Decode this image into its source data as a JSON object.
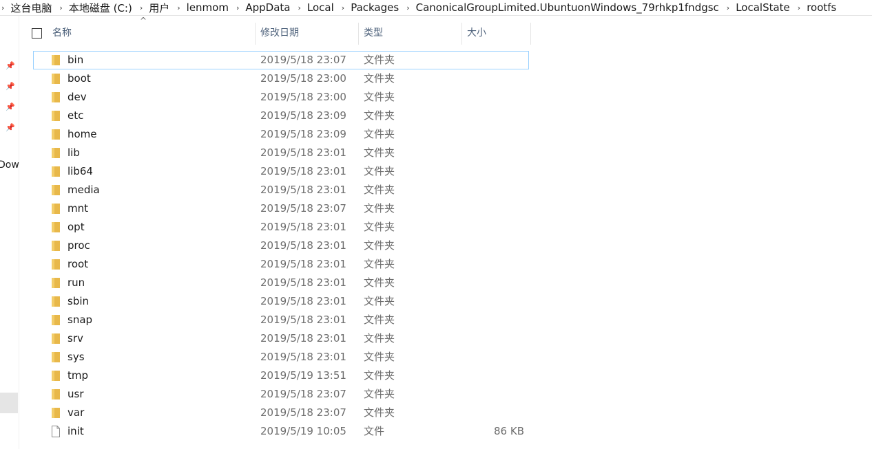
{
  "breadcrumb": [
    "这台电脑",
    "本地磁盘 (C:)",
    "用户",
    "lenmom",
    "AppData",
    "Local",
    "Packages",
    "CanonicalGroupLimited.UbuntuonWindows_79rhkp1fndgsc",
    "LocalState",
    "rootfs"
  ],
  "nav_partial_label": "Dow",
  "columns": {
    "name": "名称",
    "modified": "修改日期",
    "type": "类型",
    "size": "大小"
  },
  "colors": {
    "folder": "#e8b84a",
    "selection_border": "#99d1ff",
    "header_text": "#4c607a"
  },
  "files": [
    {
      "name": "bin",
      "modified": "2019/5/18 23:07",
      "type": "文件夹",
      "size": "",
      "icon": "folder-icon"
    },
    {
      "name": "boot",
      "modified": "2019/5/18 23:00",
      "type": "文件夹",
      "size": "",
      "icon": "folder-icon"
    },
    {
      "name": "dev",
      "modified": "2019/5/18 23:00",
      "type": "文件夹",
      "size": "",
      "icon": "folder-icon"
    },
    {
      "name": "etc",
      "modified": "2019/5/18 23:09",
      "type": "文件夹",
      "size": "",
      "icon": "folder-icon"
    },
    {
      "name": "home",
      "modified": "2019/5/18 23:09",
      "type": "文件夹",
      "size": "",
      "icon": "folder-icon"
    },
    {
      "name": "lib",
      "modified": "2019/5/18 23:01",
      "type": "文件夹",
      "size": "",
      "icon": "folder-icon"
    },
    {
      "name": "lib64",
      "modified": "2019/5/18 23:01",
      "type": "文件夹",
      "size": "",
      "icon": "folder-icon"
    },
    {
      "name": "media",
      "modified": "2019/5/18 23:01",
      "type": "文件夹",
      "size": "",
      "icon": "folder-icon"
    },
    {
      "name": "mnt",
      "modified": "2019/5/18 23:07",
      "type": "文件夹",
      "size": "",
      "icon": "folder-icon"
    },
    {
      "name": "opt",
      "modified": "2019/5/18 23:01",
      "type": "文件夹",
      "size": "",
      "icon": "folder-icon"
    },
    {
      "name": "proc",
      "modified": "2019/5/18 23:01",
      "type": "文件夹",
      "size": "",
      "icon": "folder-icon"
    },
    {
      "name": "root",
      "modified": "2019/5/18 23:01",
      "type": "文件夹",
      "size": "",
      "icon": "folder-icon"
    },
    {
      "name": "run",
      "modified": "2019/5/18 23:01",
      "type": "文件夹",
      "size": "",
      "icon": "folder-icon"
    },
    {
      "name": "sbin",
      "modified": "2019/5/18 23:01",
      "type": "文件夹",
      "size": "",
      "icon": "folder-icon"
    },
    {
      "name": "snap",
      "modified": "2019/5/18 23:01",
      "type": "文件夹",
      "size": "",
      "icon": "folder-icon"
    },
    {
      "name": "srv",
      "modified": "2019/5/18 23:01",
      "type": "文件夹",
      "size": "",
      "icon": "folder-icon"
    },
    {
      "name": "sys",
      "modified": "2019/5/18 23:01",
      "type": "文件夹",
      "size": "",
      "icon": "folder-icon"
    },
    {
      "name": "tmp",
      "modified": "2019/5/19 13:51",
      "type": "文件夹",
      "size": "",
      "icon": "folder-icon"
    },
    {
      "name": "usr",
      "modified": "2019/5/18 23:07",
      "type": "文件夹",
      "size": "",
      "icon": "folder-icon"
    },
    {
      "name": "var",
      "modified": "2019/5/18 23:07",
      "type": "文件夹",
      "size": "",
      "icon": "folder-icon"
    },
    {
      "name": "init",
      "modified": "2019/5/19 10:05",
      "type": "文件",
      "size": "86 KB",
      "icon": "file-icon"
    }
  ]
}
